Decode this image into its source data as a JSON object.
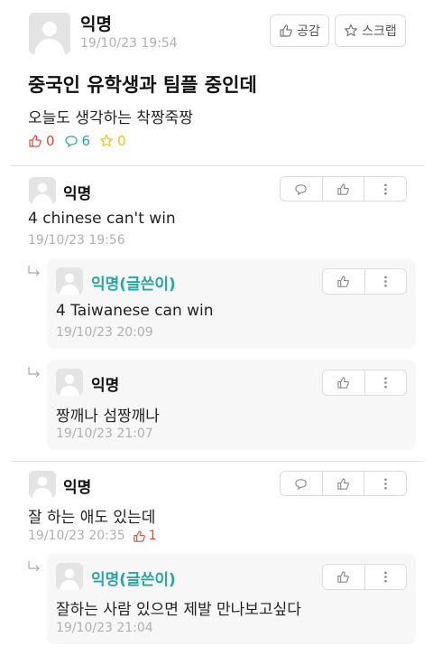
{
  "post": {
    "author": "익명",
    "timestamp": "19/10/23 19:54",
    "title": "중국인 유학생과 팀플 중인데",
    "body": "오늘도 생각하는 착짱죽짱",
    "like_label": "공감",
    "scrap_label": "스크랩",
    "stats": {
      "likes": "0",
      "comments": "6",
      "scraps": "0"
    }
  },
  "comments": [
    {
      "author": "익명",
      "text": "4 chinese can't win",
      "timestamp": "19/10/23 19:56"
    },
    {
      "author": "익명(글쓴이)",
      "text": "4 Taiwanese can win",
      "timestamp": "19/10/23 20:09"
    },
    {
      "author": "익명",
      "text": "짱깨나 섬짱깨나",
      "timestamp": "19/10/23 21:07"
    },
    {
      "author": "익명",
      "text": "잘 하는 애도 있는데",
      "timestamp": "19/10/23 20:35",
      "likes": "1"
    },
    {
      "author": "익명(글쓴이)",
      "text": "잘하는 사람 있으면 제발 만나보고싶다",
      "timestamp": "19/10/23 21:04"
    }
  ],
  "colors": {
    "like_red": "#e0463a",
    "comment_teal": "#2aa5a4",
    "scrap_yellow": "#f2c21b"
  },
  "icons": [
    "thumbs-up-icon",
    "star-icon",
    "speech-bubble-icon",
    "more-vertical-icon",
    "reply-arrow-icon",
    "avatar-silhouette"
  ]
}
